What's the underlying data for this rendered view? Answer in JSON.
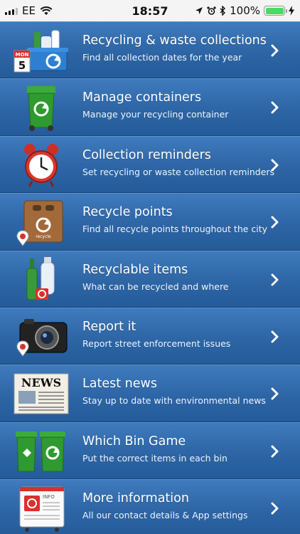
{
  "status_bar": {
    "carrier": "EE",
    "time": "18:57",
    "battery": "100%"
  },
  "menu": [
    {
      "title": "Recycling & waste collections",
      "subtitle": "Find all collection dates for the year",
      "icon": "calendar-recycling-icon"
    },
    {
      "title": "Manage containers",
      "subtitle": "Manage your recycling container",
      "icon": "green-bin-icon"
    },
    {
      "title": "Collection reminders",
      "subtitle": "Set recycling or waste collection reminders",
      "icon": "alarm-clock-icon"
    },
    {
      "title": "Recycle points",
      "subtitle": "Find all recycle points throughout the city",
      "icon": "recycle-bank-icon"
    },
    {
      "title": "Recyclable items",
      "subtitle": "What can be recycled and where",
      "icon": "bottles-icon"
    },
    {
      "title": "Report it",
      "subtitle": "Report street enforcement issues",
      "icon": "camera-icon"
    },
    {
      "title": "Latest news",
      "subtitle": "Stay up to date with environmental news",
      "icon": "newspaper-icon"
    },
    {
      "title": "Which Bin Game",
      "subtitle": "Put the correct items in each bin",
      "icon": "bins-game-icon"
    },
    {
      "title": "More information",
      "subtitle": "All our contact details & App settings",
      "icon": "info-card-icon"
    }
  ],
  "icon_text": {
    "calendar_month": "MON",
    "calendar_day": "5",
    "news_masthead": "NEWS",
    "info_card": "INFO",
    "recycle_label": "recycle"
  }
}
